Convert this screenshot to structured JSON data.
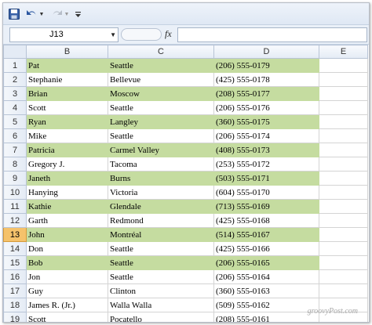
{
  "formula_bar": {
    "name_box": "J13",
    "fx_label": "fx",
    "formula_value": ""
  },
  "columns": [
    "B",
    "C",
    "D",
    "E"
  ],
  "active_row": 13,
  "band_color": "#c5dca0",
  "rows": [
    {
      "num": "1",
      "b": "Pat",
      "c": "Seattle",
      "d": "(206) 555-0179",
      "band": true
    },
    {
      "num": "2",
      "b": "Stephanie",
      "c": "Bellevue",
      "d": "(425) 555-0178",
      "band": false
    },
    {
      "num": "3",
      "b": "Brian",
      "c": "Moscow",
      "d": "(208) 555-0177",
      "band": true
    },
    {
      "num": "4",
      "b": "Scott",
      "c": "Seattle",
      "d": "(206) 555-0176",
      "band": false
    },
    {
      "num": "5",
      "b": "Ryan",
      "c": "Langley",
      "d": "(360) 555-0175",
      "band": true
    },
    {
      "num": "6",
      "b": "Mike",
      "c": "Seattle",
      "d": "(206) 555-0174",
      "band": false
    },
    {
      "num": "7",
      "b": "Patricia",
      "c": "Carmel Valley",
      "d": "(408) 555-0173",
      "band": true
    },
    {
      "num": "8",
      "b": "Gregory J.",
      "c": "Tacoma",
      "d": "(253) 555-0172",
      "band": false
    },
    {
      "num": "9",
      "b": "Janeth",
      "c": "Burns",
      "d": "(503) 555-0171",
      "band": true
    },
    {
      "num": "10",
      "b": "Hanying",
      "c": "Victoria",
      "d": "(604) 555-0170",
      "band": false
    },
    {
      "num": "11",
      "b": "Kathie",
      "c": "Glendale",
      "d": "(713) 555-0169",
      "band": true
    },
    {
      "num": "12",
      "b": "Garth",
      "c": "Redmond",
      "d": "(425) 555-0168",
      "band": false
    },
    {
      "num": "13",
      "b": "John",
      "c": "Montréal",
      "d": "(514) 555-0167",
      "band": true
    },
    {
      "num": "14",
      "b": "Don",
      "c": "Seattle",
      "d": "(425) 555-0166",
      "band": false
    },
    {
      "num": "15",
      "b": "Bob",
      "c": "Seattle",
      "d": "(206) 555-0165",
      "band": true
    },
    {
      "num": "16",
      "b": "Jon",
      "c": "Seattle",
      "d": "(206) 555-0164",
      "band": false
    },
    {
      "num": "17",
      "b": "Guy",
      "c": "Clinton",
      "d": "(360) 555-0163",
      "band": false
    },
    {
      "num": "18",
      "b": "James R. (Jr.)",
      "c": "Walla Walla",
      "d": "(509) 555-0162",
      "band": false
    },
    {
      "num": "19",
      "b": "Scott",
      "c": "Pocatello",
      "d": "(208) 555-0161",
      "band": false
    }
  ],
  "watermark": "groovyPost.com"
}
